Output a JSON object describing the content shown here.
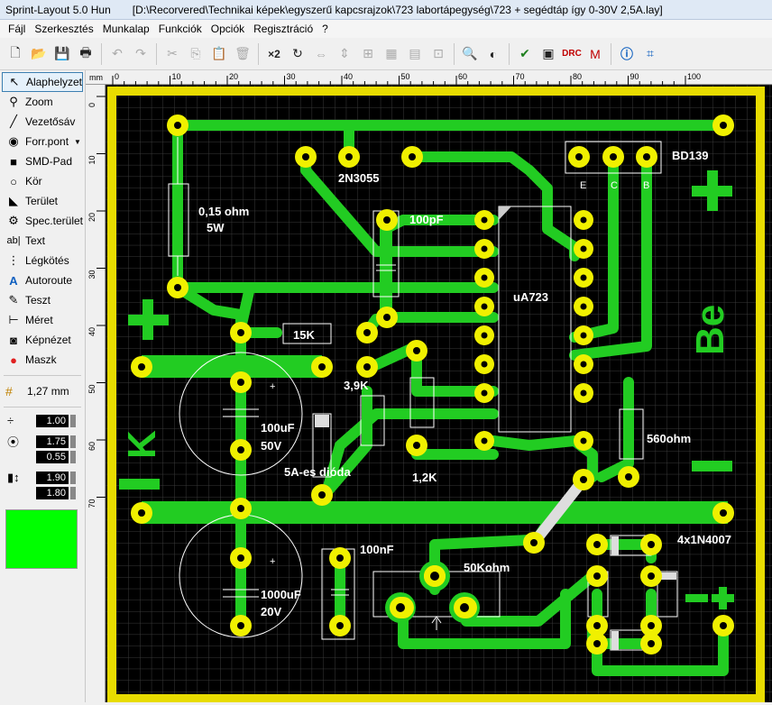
{
  "window": {
    "app_title": "Sprint-Layout 5.0 Hun",
    "file_path": "[D:\\Recorvered\\Technikai képek\\egyszerű kapcsrajzok\\723 labortápegység\\723 + segédtáp így 0-30V 2,5A.lay]"
  },
  "menu": [
    "Fájl",
    "Szerkesztés",
    "Munkalap",
    "Funkciók",
    "Opciók",
    "Regisztráció",
    "?"
  ],
  "toolbar_icons": [
    "new-icon",
    "open-icon",
    "save-icon",
    "print-icon",
    "undo-icon",
    "redo-icon",
    "cut-icon",
    "copy-icon",
    "paste-icon",
    "delete-icon",
    "duplicate-icon",
    "rotate-icon",
    "mirror-h-icon",
    "mirror-v-icon",
    "align-icon",
    "group-icon",
    "ungroup-icon",
    "snap-icon",
    "zoom-icon",
    "layer-icon",
    "drc-icon",
    "info-icon",
    "crop-icon"
  ],
  "toolbar_labels": {
    "x2": "×2",
    "help": "?"
  },
  "tools": [
    {
      "label": "Alaphelyzet",
      "icon": "cursor-icon",
      "glyph": "↖",
      "active": true
    },
    {
      "label": "Zoom",
      "icon": "magnifier-icon",
      "glyph": "⚲"
    },
    {
      "label": "Vezetősáv",
      "icon": "track-icon",
      "glyph": "╱"
    },
    {
      "label": "Forr.pont",
      "icon": "pad-icon",
      "glyph": "◉"
    },
    {
      "label": "SMD-Pad",
      "icon": "smd-pad-icon",
      "glyph": "■"
    },
    {
      "label": "Kör",
      "icon": "circle-icon",
      "glyph": "○"
    },
    {
      "label": "Terület",
      "icon": "zone-icon",
      "glyph": "◣"
    },
    {
      "label": "Spec.terület",
      "icon": "special-zone-icon",
      "glyph": "⚙"
    },
    {
      "label": "Text",
      "icon": "text-icon",
      "glyph": "ab|"
    },
    {
      "label": "Légkötés",
      "icon": "airwire-icon",
      "glyph": "⋮"
    },
    {
      "label": "Autoroute",
      "icon": "autoroute-icon",
      "glyph": "A"
    },
    {
      "label": "Teszt",
      "icon": "test-icon",
      "glyph": "✎"
    },
    {
      "label": "Méret",
      "icon": "measure-icon",
      "glyph": "⊢"
    },
    {
      "label": "Képnézet",
      "icon": "photoview-icon",
      "glyph": "◙"
    },
    {
      "label": "Maszk",
      "icon": "mask-icon",
      "glyph": "●"
    }
  ],
  "grid": {
    "label": "1,27 mm"
  },
  "params": [
    {
      "name": "track-width",
      "value": "1.00"
    },
    {
      "name": "pad-outer",
      "value": "1.75"
    },
    {
      "name": "pad-inner",
      "value": "0.55"
    },
    {
      "name": "smd-width",
      "value": "1.90"
    },
    {
      "name": "smd-height",
      "value": "1.80"
    }
  ],
  "active_color": "#00ff00",
  "ruler": {
    "unit": "mm",
    "top_ticks": [
      "0",
      "10",
      "20",
      "30",
      "40",
      "50",
      "60",
      "70",
      "80",
      "90",
      "100"
    ],
    "left_ticks": [
      "0",
      "10",
      "20",
      "30",
      "40",
      "50",
      "60",
      "70"
    ]
  },
  "pcb_labels": {
    "r1": "0,15 ohm",
    "r1b": "5W",
    "q1": "2N3055",
    "c1": "100pF",
    "q2": "BD139",
    "e": "E",
    "c": "C",
    "b": "B",
    "ic": "uA723",
    "r15k": "15K",
    "r39k": "3,9K",
    "c100u": "100uF",
    "c100ub": "50V",
    "diode": "5A-es dióda",
    "r12k": "1,2K",
    "r560": "560ohm",
    "c100n": "100nF",
    "pot": "50Kohm",
    "bridge": "4x1N4007",
    "c1000u": "1000uF",
    "c1000ub": "20V",
    "plus": "+",
    "be": "Be",
    "cap_plus": "+"
  }
}
